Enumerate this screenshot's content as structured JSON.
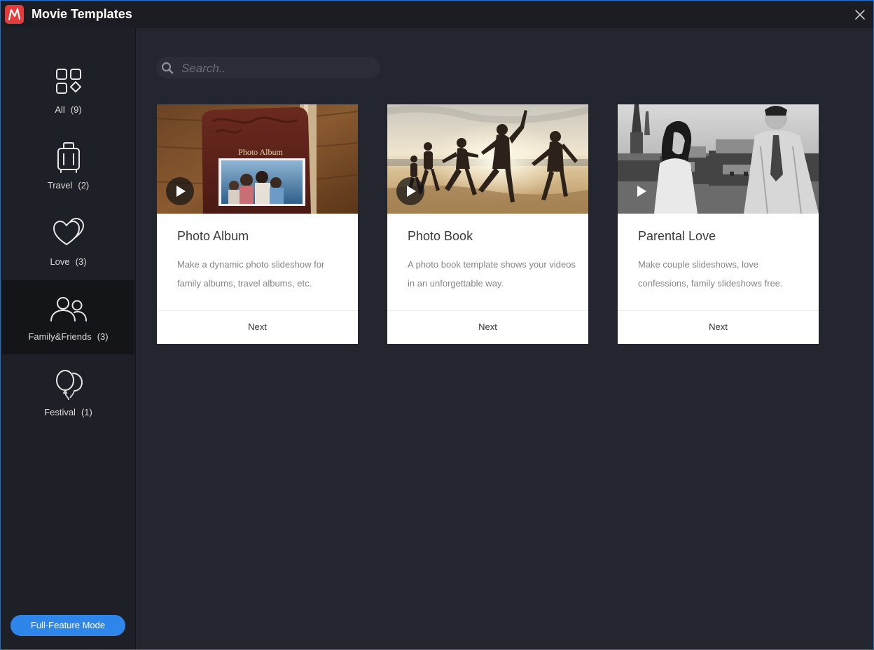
{
  "window": {
    "title": "Movie Templates"
  },
  "sidebar": {
    "items": [
      {
        "label": "All",
        "count": "(9)",
        "icon": "grid-icon"
      },
      {
        "label": "Travel",
        "count": "(2)",
        "icon": "luggage-icon"
      },
      {
        "label": "Love",
        "count": "(3)",
        "icon": "hearts-icon"
      },
      {
        "label": "Family&Friends",
        "count": "(3)",
        "icon": "people-icon",
        "active": true
      },
      {
        "label": "Festival",
        "count": "(1)",
        "icon": "balloons-icon"
      }
    ],
    "full_feature_label": "Full-Feature Mode"
  },
  "search": {
    "placeholder": "Search..",
    "value": ""
  },
  "cards": [
    {
      "title": "Photo Album",
      "description": "Make a dynamic photo slideshow for family albums, travel albums, etc.",
      "button": "Next",
      "thumb_text": "Photo Album"
    },
    {
      "title": "Photo Book",
      "description": "A photo book template shows your videos in an unforgettable way.",
      "button": "Next"
    },
    {
      "title": "Parental Love",
      "description": "Make couple slideshows, love confessions, family slideshows free.",
      "button": "Next"
    }
  ],
  "colors": {
    "accent": "#2f86ea",
    "logo": "#e23c3c",
    "window_border": "#1f6fd0"
  }
}
